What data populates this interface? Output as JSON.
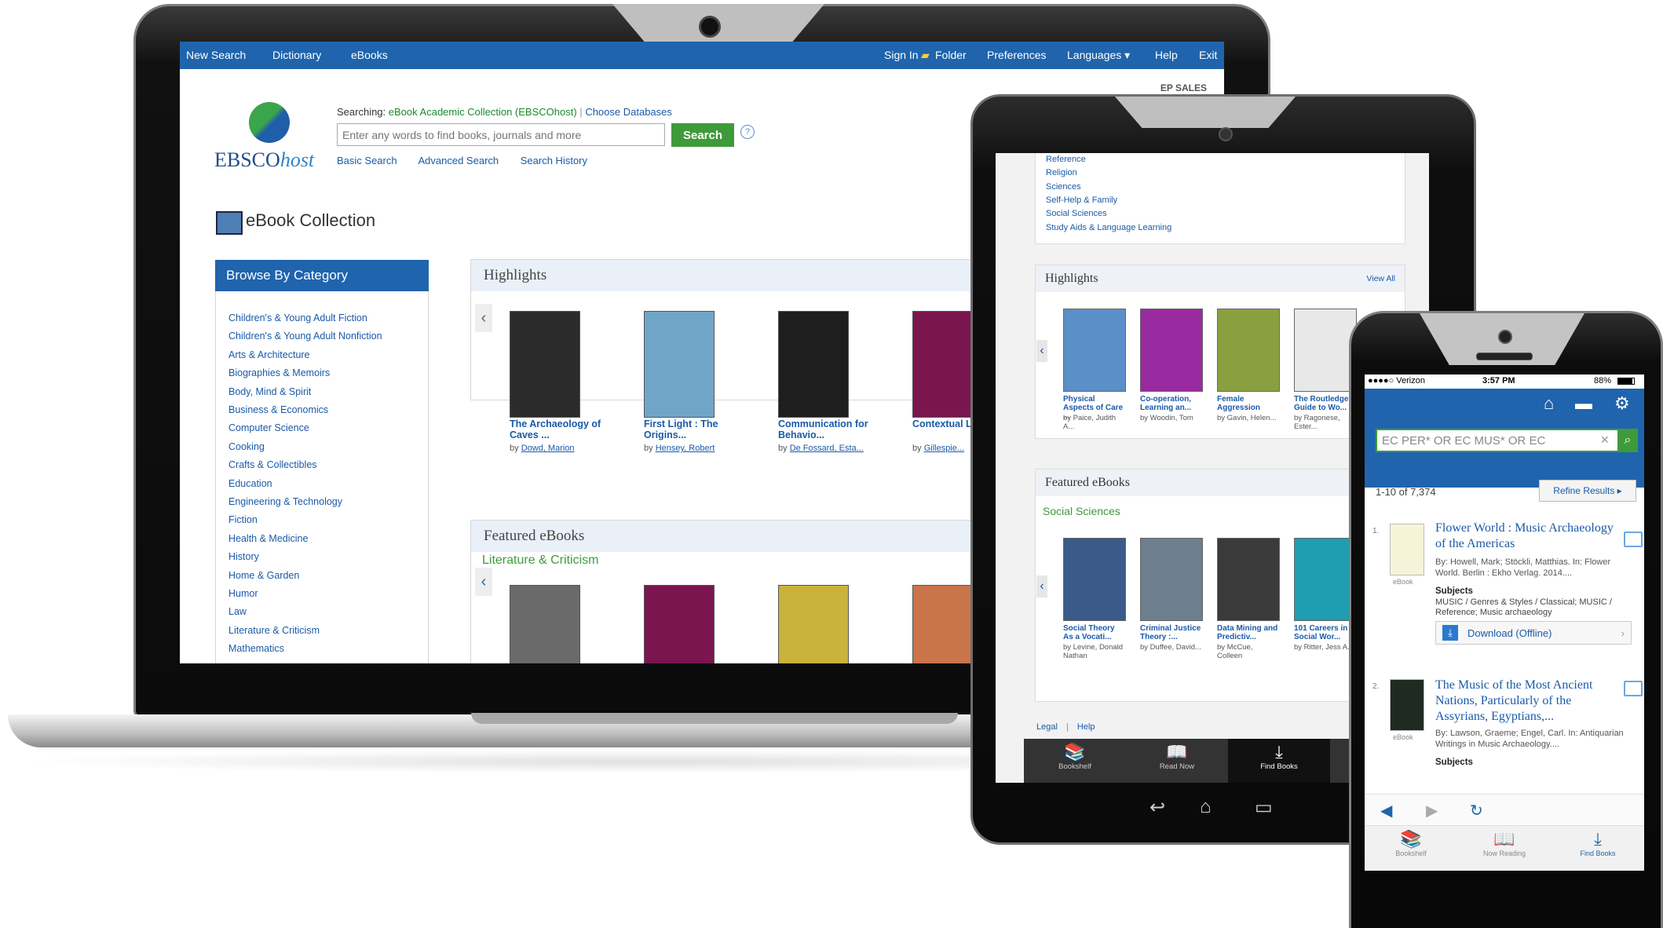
{
  "laptop": {
    "top_nav": {
      "left": [
        "New Search",
        "Dictionary",
        "eBooks"
      ],
      "sign_in": "Sign In",
      "folder": "Folder",
      "preferences": "Preferences",
      "languages": "Languages ▾",
      "help": "Help",
      "exit": "Exit"
    },
    "ep_sales": "EP SALES",
    "logo": {
      "text": "EBSCO",
      "suffix": "host"
    },
    "search": {
      "searching_label": "Searching:",
      "database": "eBook Academic Collection (EBSCOhost)",
      "separator": "|",
      "choose_databases": "Choose Databases",
      "placeholder": "Enter any words to find books, journals and more",
      "button": "Search",
      "help": "?",
      "links": [
        "Basic Search",
        "Advanced Search",
        "Search History"
      ]
    },
    "collection_title": "eBook Collection",
    "browse": {
      "heading": "Browse By Category",
      "categories": [
        "Children's & Young Adult Fiction",
        "Children's & Young Adult Nonfiction",
        "Arts & Architecture",
        "Biographies & Memoirs",
        "Body, Mind & Spirit",
        "Business & Economics",
        "Computer Science",
        "Cooking",
        "Crafts & Collectibles",
        "Education",
        "Engineering & Technology",
        "Fiction",
        "Health & Medicine",
        "History",
        "Home & Garden",
        "Humor",
        "Law",
        "Literature & Criticism",
        "Mathematics"
      ]
    },
    "highlights": {
      "heading": "Highlights",
      "prev": "‹",
      "books": [
        {
          "title": "The Archaeology of Caves ...",
          "by": "by",
          "author": "Dowd, Marion",
          "cover": "#2b2b2b"
        },
        {
          "title": "First Light : The Origins...",
          "by": "by",
          "author": "Hensey, Robert",
          "cover": "#6fa6c8"
        },
        {
          "title": "Communication for Behavio...",
          "by": "by",
          "author": "De Fossard, Esta...",
          "cover": "#1e1e1e"
        },
        {
          "title": "Contextual Lit...",
          "by": "by",
          "author": "Gillespie...",
          "cover": "#7a1550"
        }
      ]
    },
    "featured": {
      "heading": "Featured eBooks",
      "subheading": "Literature & Criticism",
      "prev": "‹",
      "covers": [
        "#6a6a6a",
        "#7a1550",
        "#c9b33a",
        "#c9744a"
      ]
    }
  },
  "tablet": {
    "top_links": [
      "Reference",
      "Religion",
      "Sciences",
      "Self-Help & Family",
      "Social Sciences",
      "Study Aids & Language Learning"
    ],
    "highlights": {
      "heading": "Highlights",
      "view_all": "View All",
      "prev": "‹",
      "books": [
        {
          "title": "Physical Aspects of Care ...",
          "author": "by Paice, Judith A...",
          "cover": "#5b8fc8"
        },
        {
          "title": "Co-operation, Learning an...",
          "author": "by Woodin, Tom",
          "cover": "#9a2aa0"
        },
        {
          "title": "Female Aggression",
          "author": "by Gavin, Helen...",
          "cover": "#8aa040"
        },
        {
          "title": "The Routledge Guide to Wo...",
          "author": "by Ragonese, Ester...",
          "cover": "#e8e8e8"
        }
      ]
    },
    "featured": {
      "heading": "Featured eBooks",
      "subheading": "Social Sciences",
      "prev": "‹",
      "books": [
        {
          "title": "Social Theory As a Vocati...",
          "author": "by Levine, Donald Nathan",
          "cover": "#3a5a8a"
        },
        {
          "title": "Criminal Justice Theory :...",
          "author": "by Duffee, David...",
          "cover": "#6d7f8f"
        },
        {
          "title": "Data Mining and Predictiv...",
          "author": "by McCue, Colleen",
          "cover": "#3b3b3b"
        },
        {
          "title": "101 Careers in Social Wor...",
          "author": "by Ritter, Jess A...",
          "cover": "#1e9eb0"
        }
      ]
    },
    "footer": {
      "legal": "Legal",
      "sep": "|",
      "help": "Help"
    },
    "tabs": [
      {
        "icon": "📚",
        "label": "Bookshelf"
      },
      {
        "icon": "📖",
        "label": "Read Now"
      },
      {
        "icon": "⤓",
        "label": "Find Books"
      }
    ],
    "android_nav": [
      "↩",
      "⌂",
      "▭"
    ]
  },
  "phone": {
    "status": {
      "carrier": "●●●●○ Verizon",
      "time": "3:57 PM",
      "battery": "88%"
    },
    "header_icons": [
      "⌂",
      "▬",
      "⚙"
    ],
    "search": {
      "value": "EC PER* OR EC MUS* OR EC",
      "clear": "✕",
      "button": "⌕"
    },
    "result_count": "1-10 of 7,374",
    "refine": "Refine Results ▸",
    "results": [
      {
        "num": "1.",
        "type": "eBook",
        "title": "Flower World : Music Archaeology of the Americas",
        "meta": "By: Howell, Mark; Stöckli, Matthias. In: Flower World. Berlin : Ekho Verlag. 2014....",
        "subjects_label": "Subjects",
        "subjects": "MUSIC / Genres & Styles / Classical; MUSIC / Reference; Music archaeology",
        "download": "Download (Offline)",
        "download_arrow": "›"
      },
      {
        "num": "2.",
        "type": "eBook",
        "title": "The Music of the Most Ancient Nations, Particularly of the Assyrians, Egyptians,...",
        "meta": "By: Lawson, Graeme; Engel, Carl. In: Antiquarian Writings in Music Archaeology....",
        "subjects_label": "Subjects"
      }
    ],
    "nav": [
      "◀",
      "▶",
      "↻"
    ],
    "tabs": [
      {
        "icon": "📚",
        "label": "Bookshelf"
      },
      {
        "icon": "📖",
        "label": "Now Reading"
      },
      {
        "icon": "⤓",
        "label": "Find Books"
      }
    ]
  }
}
